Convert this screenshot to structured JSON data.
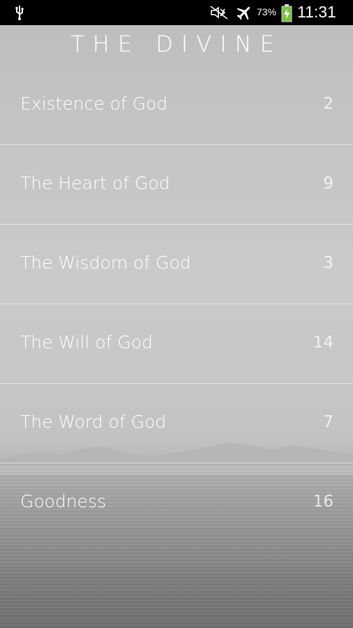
{
  "status_bar": {
    "battery_percent": "73%",
    "time": "11:31",
    "icons": [
      "usb-icon",
      "mute-icon",
      "airplane-mode-icon",
      "battery-charging-icon"
    ]
  },
  "app": {
    "title": "THE DIVINE"
  },
  "chapters": [
    {
      "title": "Existence of God",
      "count": "2"
    },
    {
      "title": "The Heart of God",
      "count": "9"
    },
    {
      "title": "The Wisdom of God",
      "count": "3"
    },
    {
      "title": "The Will of God",
      "count": "14"
    },
    {
      "title": "The Word of God",
      "count": "7"
    },
    {
      "title": "Goodness",
      "count": "16"
    }
  ],
  "colors": {
    "status_bar": "#000000",
    "text": "#ffffff",
    "battery_green": "#7ac143"
  }
}
